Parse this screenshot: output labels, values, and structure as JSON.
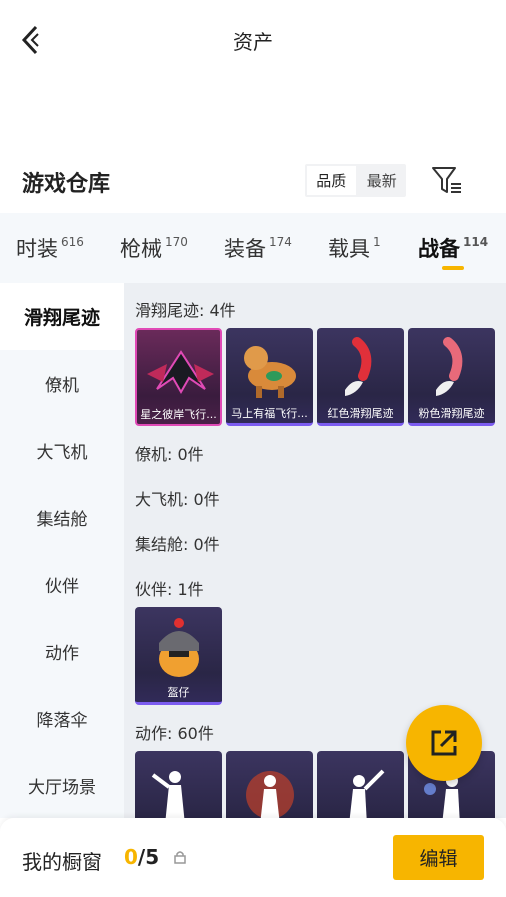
{
  "header": {
    "title": "资产"
  },
  "warehouse": {
    "title": "游戏仓库",
    "sort_options": [
      "品质",
      "最新"
    ],
    "active_sort": "品质"
  },
  "tabs": [
    {
      "label": "时装",
      "count": "616"
    },
    {
      "label": "枪械",
      "count": "170"
    },
    {
      "label": "装备",
      "count": "174"
    },
    {
      "label": "载具",
      "count": "1"
    },
    {
      "label": "战备",
      "count": "114"
    }
  ],
  "active_tab": "战备",
  "sidenav": [
    "滑翔尾迹",
    "僚机",
    "大飞机",
    "集结舱",
    "伙伴",
    "动作",
    "降落伞",
    "大厅场景"
  ],
  "sections": {
    "glide": {
      "label": "滑翔尾迹: 4件",
      "items": [
        "星之彼岸飞行...",
        "马上有福飞行...",
        "红色滑翔尾迹",
        "粉色滑翔尾迹"
      ]
    },
    "wingman": {
      "label": "僚机: 0件"
    },
    "bigplane": {
      "label": "大飞机: 0件"
    },
    "pod": {
      "label": "集结舱: 0件"
    },
    "partner": {
      "label": "伙伴: 1件",
      "items": [
        "盔仔"
      ]
    },
    "emote": {
      "label": "动作: 60件"
    }
  },
  "bottombar": {
    "label": "我的橱窗",
    "current": "0",
    "total": "/5",
    "edit_label": "编辑"
  },
  "colors": {
    "accent": "#f7b500",
    "card_bg": "#2a2646",
    "card_border": "#7c5cf0"
  }
}
